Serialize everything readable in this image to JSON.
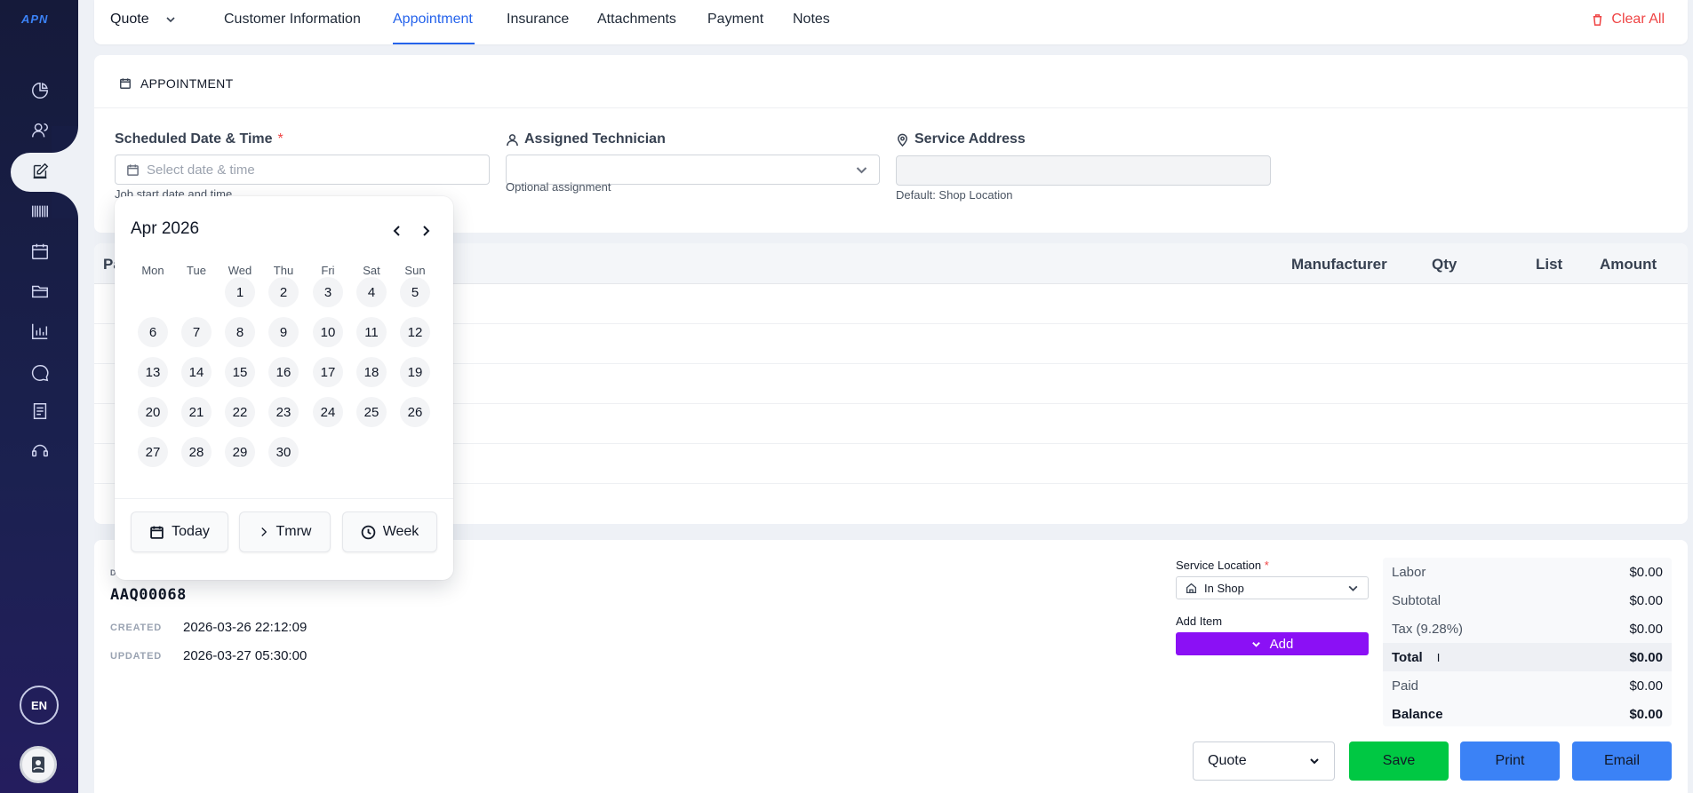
{
  "app": {
    "logo": "APN",
    "language": "EN"
  },
  "sidebar": {
    "items": [
      {
        "icon": "pie-chart-icon"
      },
      {
        "icon": "users-icon"
      },
      {
        "icon": "edit-icon",
        "active": true
      },
      {
        "icon": "barcode-icon"
      },
      {
        "icon": "calendar-icon"
      },
      {
        "icon": "folder-icon"
      },
      {
        "icon": "bar-chart-icon"
      },
      {
        "icon": "chat-icon"
      },
      {
        "icon": "document-icon"
      },
      {
        "icon": "support-icon"
      }
    ]
  },
  "header": {
    "doc_type": "Quote",
    "tabs": [
      {
        "label": "Customer Information"
      },
      {
        "label": "Appointment",
        "active": true
      },
      {
        "label": "Insurance"
      },
      {
        "label": "Attachments"
      },
      {
        "label": "Payment"
      },
      {
        "label": "Notes"
      }
    ],
    "clear_all": "Clear All"
  },
  "appointment": {
    "section_title": "APPOINTMENT",
    "scheduled": {
      "label": "Scheduled Date & Time",
      "required_mark": "*",
      "placeholder": "Select date & time",
      "hint": "Job start date and time"
    },
    "technician": {
      "label": "Assigned Technician",
      "value": "",
      "hint": "Optional assignment"
    },
    "address": {
      "label": "Service Address",
      "value": "",
      "hint": "Default: Shop Location"
    }
  },
  "parts_table": {
    "first_column_visible": "Pa",
    "columns": [
      "Manufacturer",
      "Qty",
      "List",
      "Amount"
    ]
  },
  "date_picker": {
    "month_label": "Apr 2026",
    "weekdays": [
      "Mon",
      "Tue",
      "Wed",
      "Thu",
      "Fri",
      "Sat",
      "Sun"
    ],
    "days": [
      "1",
      "2",
      "3",
      "4",
      "5",
      "6",
      "7",
      "8",
      "9",
      "10",
      "11",
      "12",
      "13",
      "14",
      "15",
      "16",
      "17",
      "18",
      "19",
      "20",
      "21",
      "22",
      "23",
      "24",
      "25",
      "26",
      "27",
      "28",
      "29",
      "30"
    ],
    "quick": {
      "today": "Today",
      "tomorrow": "Tmrw",
      "week": "Week"
    }
  },
  "document": {
    "id_label": "D",
    "id": "AAQ00068",
    "created_label": "CREATED",
    "created": "2026-03-26 22:12:09",
    "updated_label": "UPDATED",
    "updated": "2026-03-27 05:30:00"
  },
  "service": {
    "location_label": "Service Location",
    "required_mark": "*",
    "location_value": "In Shop",
    "add_item_label": "Add Item",
    "add_button": "Add"
  },
  "totals": {
    "labor_label": "Labor",
    "labor": "$0.00",
    "subtotal_label": "Subtotal",
    "subtotal": "$0.00",
    "tax_label": "Tax (9.28%)",
    "tax": "$0.00",
    "total_label": "Total",
    "total": "$0.00",
    "paid_label": "Paid",
    "paid": "$0.00",
    "balance_label": "Balance",
    "balance": "$0.00"
  },
  "actions": {
    "doc_type_select": "Quote",
    "save": "Save",
    "print": "Print",
    "email": "Email"
  },
  "colors": {
    "accent": "#2563eb",
    "danger": "#ef4444",
    "add_button": "#8b10f5",
    "save_button": "#00c843",
    "print_button": "#3b82f6"
  }
}
